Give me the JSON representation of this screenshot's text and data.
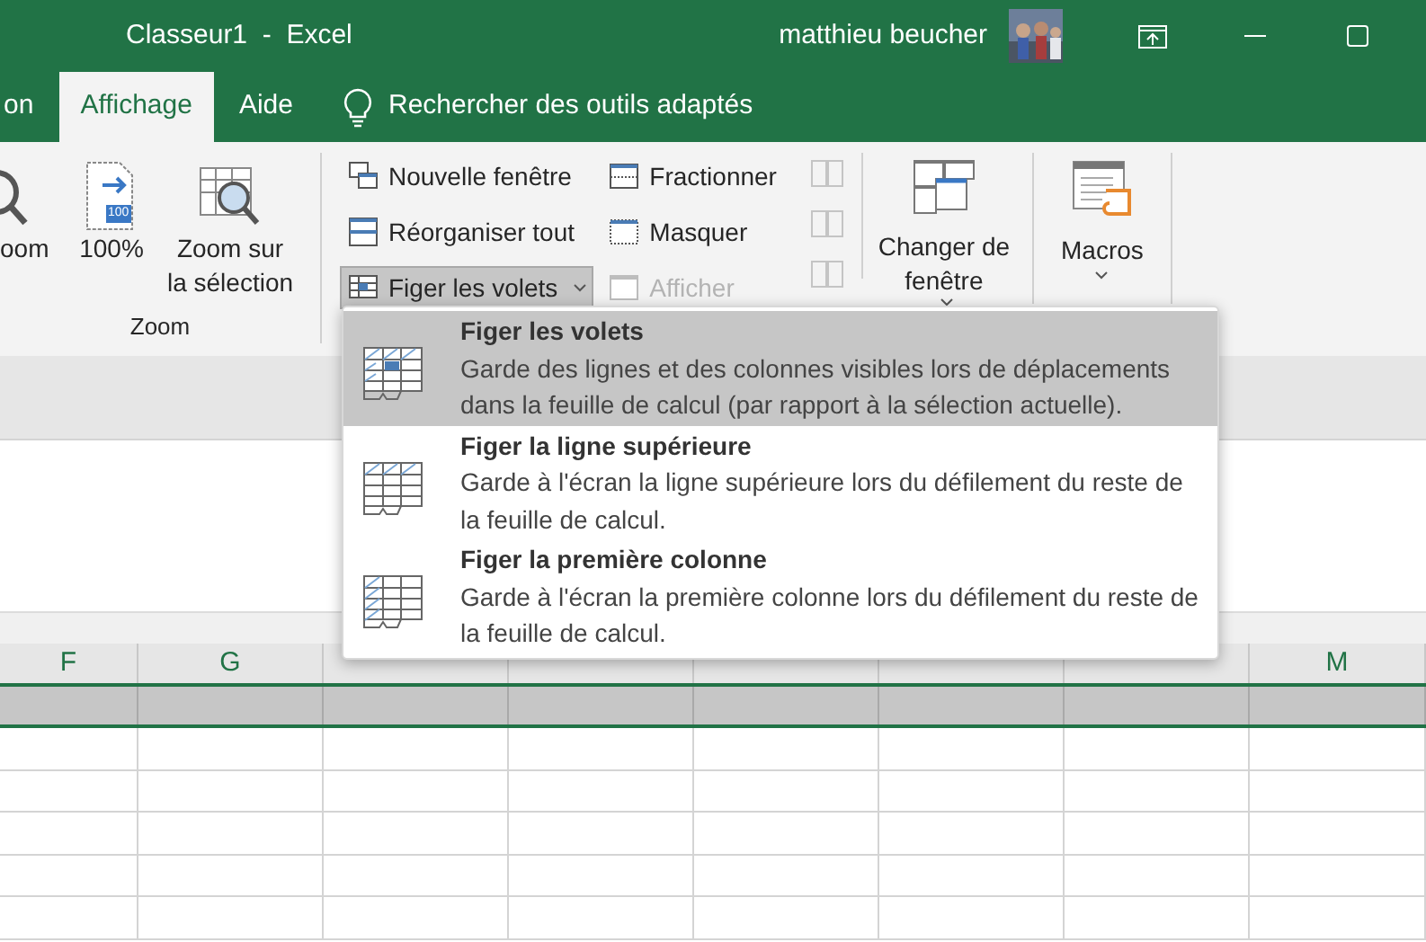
{
  "title_bar": {
    "title": "Classeur1  -  Excel",
    "user": "matthieu beucher"
  },
  "tabs": [
    {
      "label": "on",
      "selected": false
    },
    {
      "label": "Affichage",
      "selected": true
    },
    {
      "label": "Aide",
      "selected": false
    }
  ],
  "search": {
    "label": "Rechercher des outils adaptés"
  },
  "zoom_group": {
    "label": "Zoom",
    "buttons": [
      {
        "kind": "zoom",
        "label": "oom"
      },
      {
        "kind": "hundred",
        "label": "100%",
        "badge": "100"
      },
      {
        "kind": "selection",
        "label": "Zoom sur la sélection"
      }
    ]
  },
  "window_group": {
    "small_buttons": [
      {
        "kind": "new",
        "label": "Nouvelle fenêtre",
        "pressed": false,
        "disabled": false,
        "dropdown": false
      },
      {
        "kind": "arrange",
        "label": "Réorganiser tout",
        "pressed": false,
        "disabled": false,
        "dropdown": false
      },
      {
        "kind": "freeze",
        "label": "Figer les volets",
        "pressed": true,
        "disabled": false,
        "dropdown": true
      },
      {
        "kind": "split",
        "label": "Fractionner",
        "pressed": false,
        "disabled": false,
        "dropdown": false
      },
      {
        "kind": "hide",
        "label": "Masquer",
        "pressed": false,
        "disabled": false,
        "dropdown": false
      },
      {
        "kind": "unhide",
        "label": "Afficher",
        "pressed": false,
        "disabled": true,
        "dropdown": false
      }
    ],
    "switch_label": "Changer de fenêtre"
  },
  "macros_group": {
    "label": "Macros"
  },
  "menu": [
    {
      "kind": "panes",
      "title": "Figer les volets",
      "description": "Garde des lignes et des colonnes visibles lors de déplacements dans la feuille de calcul (par rapport à la sélection actuelle).",
      "selected": true
    },
    {
      "kind": "row",
      "title": "Figer la ligne supérieure",
      "description": "Garde à l'écran la ligne supérieure lors du défilement du reste de la feuille de calcul.",
      "selected": false
    },
    {
      "kind": "column",
      "title": "Figer la première colonne",
      "description": "Garde à l'écran la première colonne lors du défilement du reste de la feuille de calcul.",
      "selected": false
    }
  ],
  "columns_left": [
    "F",
    "G"
  ],
  "columns_right": [
    "M"
  ],
  "rows": [
    {
      "selected": true
    },
    {
      "selected": false
    },
    {
      "selected": false
    },
    {
      "selected": false
    },
    {
      "selected": false
    },
    {
      "selected": false
    }
  ]
}
